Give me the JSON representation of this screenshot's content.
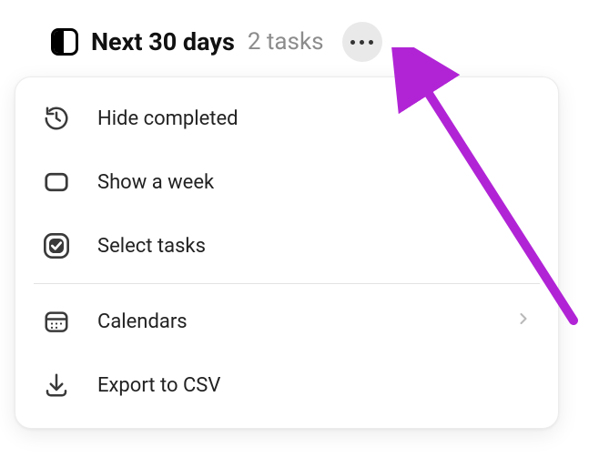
{
  "header": {
    "title": "Next 30 days",
    "task_count_label": "2 tasks"
  },
  "menu": {
    "hide_completed": "Hide completed",
    "show_week": "Show a week",
    "select_tasks": "Select tasks",
    "calendars": "Calendars",
    "export_csv": "Export to CSV"
  },
  "colors": {
    "annotation_arrow": "#b124d6"
  }
}
